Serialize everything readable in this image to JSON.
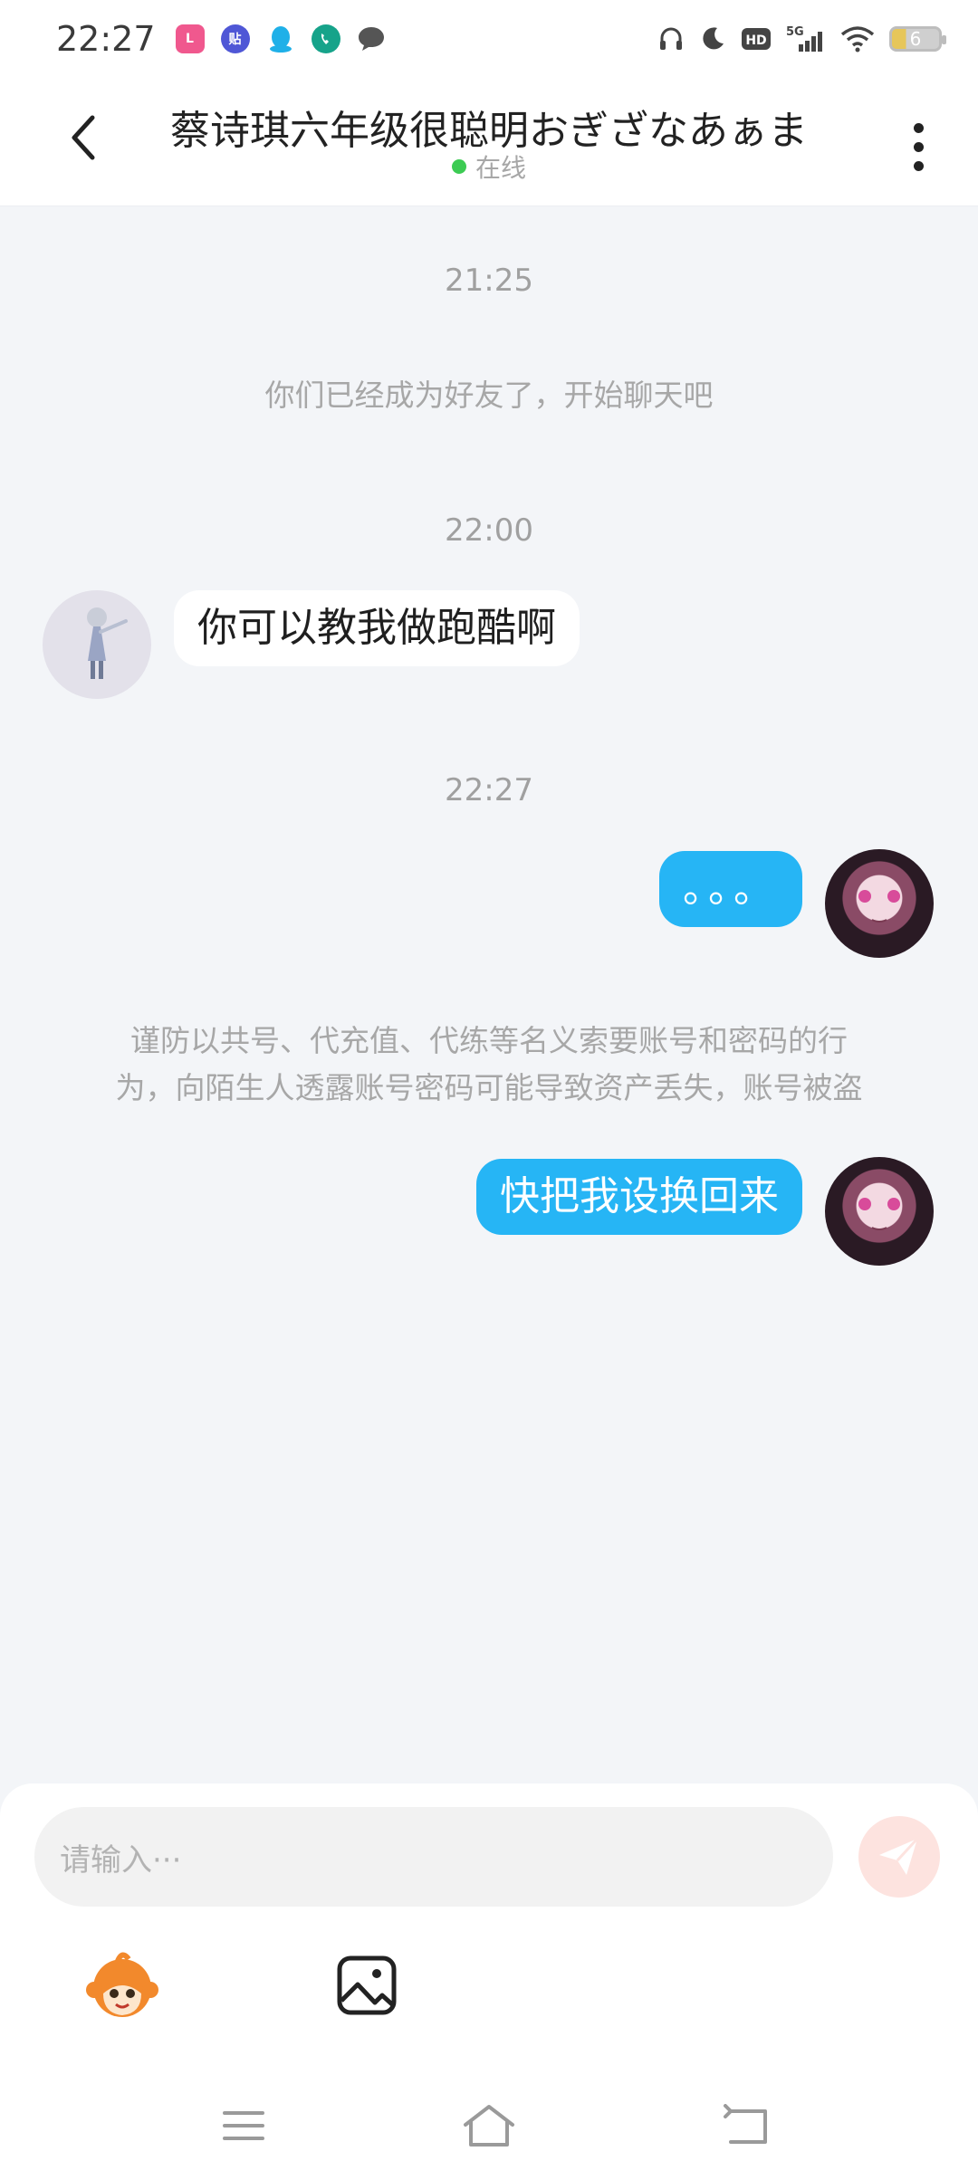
{
  "status_bar": {
    "time": "22:27",
    "notifications": [
      "lofter-icon",
      "tieba-icon",
      "qq-icon",
      "phone-app-icon",
      "message-icon"
    ],
    "system": [
      "headphones-icon",
      "moon-icon",
      "hd-icon",
      "signal-5g-icon",
      "wifi-icon",
      "battery-icon"
    ],
    "battery_level": "6"
  },
  "header": {
    "title": "蔡诗琪六年级很聪明おぎざなあぁま",
    "status": "在线"
  },
  "messages": {
    "time_1": "21:25",
    "system_friend": "你们已经成为好友了，开始聊天吧",
    "time_2": "22:00",
    "incoming_1": "你可以教我做跑酷啊",
    "time_3": "22:27",
    "outgoing_1": "。。。",
    "warning_line1": "谨防以共号、代充值、代练等名义索要账号和密码的行",
    "warning_line2": "为，向陌生人透露账号密码可能导致资产丢失，账号被盗",
    "outgoing_2": "快把我设换回来"
  },
  "input": {
    "placeholder": "请输入···"
  },
  "colors": {
    "accent": "#26b5f5",
    "online": "#3ccb53",
    "send_disabled": "#fde3df"
  }
}
